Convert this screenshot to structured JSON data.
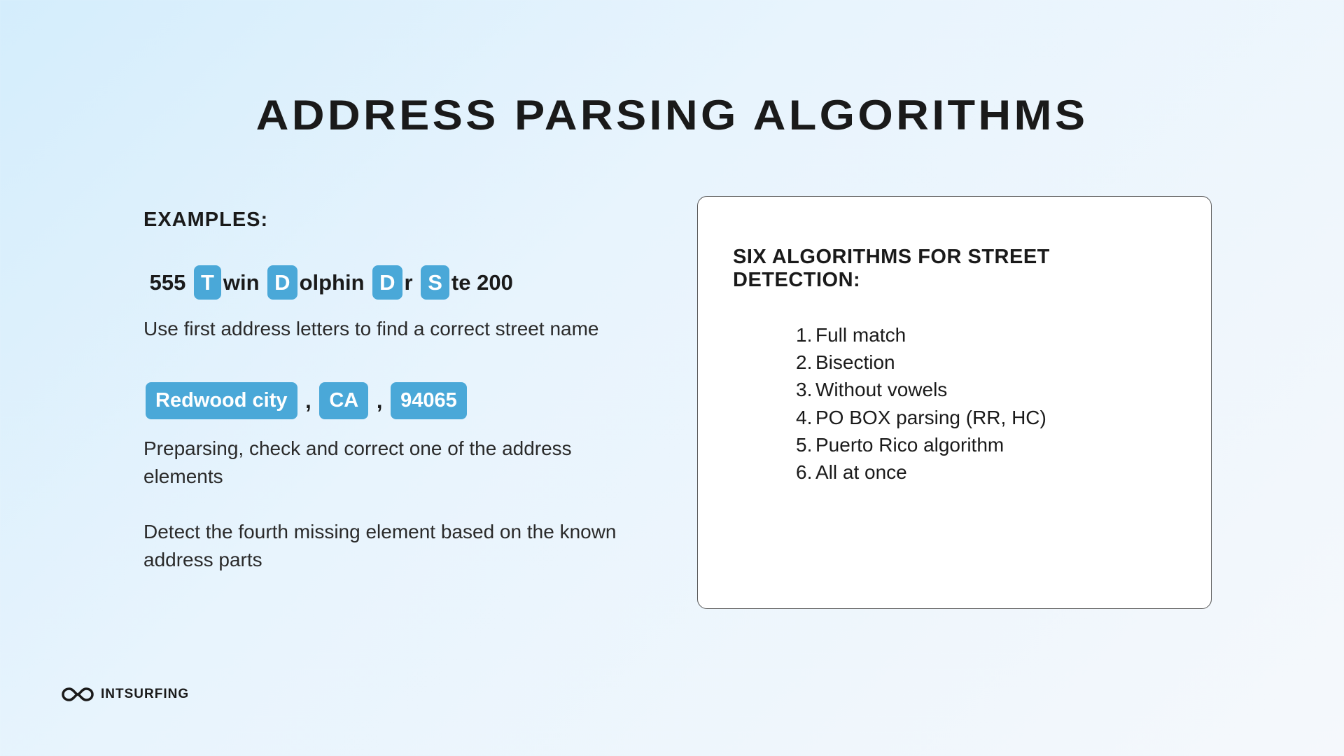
{
  "title": "ADDRESS PARSING ALGORITHMS",
  "examples_label": "EXAMPLES:",
  "example1": {
    "parts": [
      {
        "type": "text",
        "value": " 555 "
      },
      {
        "type": "chip",
        "value": "T"
      },
      {
        "type": "text",
        "value": "win "
      },
      {
        "type": "chip",
        "value": "D"
      },
      {
        "type": "text",
        "value": "olphin "
      },
      {
        "type": "chip",
        "value": "D"
      },
      {
        "type": "text",
        "value": "r "
      },
      {
        "type": "chip",
        "value": "S"
      },
      {
        "type": "text",
        "value": "te 200"
      }
    ],
    "desc": "Use first address letters to find a correct street name"
  },
  "example2": {
    "parts": [
      {
        "type": "chipbig",
        "value": "Redwood city"
      },
      {
        "type": "text",
        "value": " , "
      },
      {
        "type": "chipbig",
        "value": "CA"
      },
      {
        "type": "text",
        "value": " , "
      },
      {
        "type": "chipbig",
        "value": "94065"
      }
    ],
    "desc1": "Preparsing, check and correct one of the address elements",
    "desc2": "Detect the fourth missing element based on the known address parts"
  },
  "card": {
    "title": "SIX ALGORITHMS FOR STREET DETECTION:",
    "items": [
      "Full match",
      "Bisection",
      "Without vowels",
      "PO BOX parsing (RR, HC)",
      "Puerto Rico algorithm",
      "All at once"
    ]
  },
  "logo_text": "INTSURFING"
}
